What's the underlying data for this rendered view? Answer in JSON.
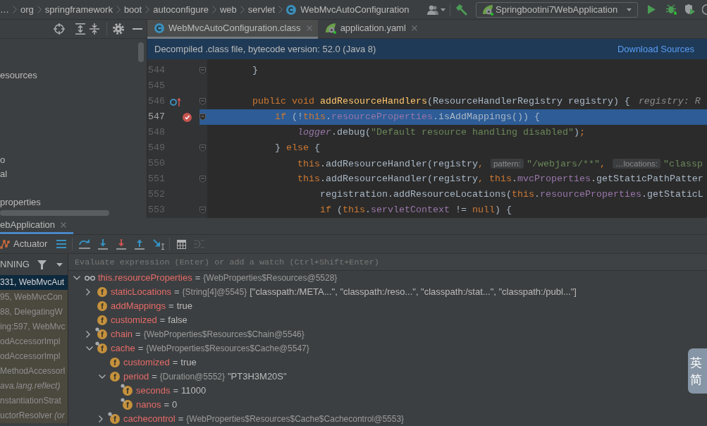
{
  "breadcrumbs": [
    {
      "kind": "package",
      "label": "…"
    },
    {
      "kind": "package",
      "label": "org"
    },
    {
      "kind": "package",
      "label": "springframework"
    },
    {
      "kind": "package",
      "label": "boot"
    },
    {
      "kind": "package",
      "label": "autoconfigure"
    },
    {
      "kind": "package",
      "label": "web"
    },
    {
      "kind": "package",
      "label": "servlet"
    },
    {
      "kind": "class",
      "label": "WebMvcAutoConfiguration"
    }
  ],
  "run_config": {
    "label": "Springbootini7WebApplication"
  },
  "editor_tabs": [
    {
      "kind": "class",
      "label": "WebMvcAutoConfiguration.class",
      "selected": true
    },
    {
      "kind": "yaml",
      "label": "application.yaml",
      "selected": false
    }
  ],
  "project_tree": [
    {
      "label": "esources"
    },
    {
      "label": "o"
    },
    {
      "label": "al"
    },
    {
      "label": "properties"
    }
  ],
  "banner": {
    "text": "Decompiled .class file, bytecode version: 52.0 (Java 8)",
    "link": "Download Sources"
  },
  "code_lines": [
    {
      "number": "544",
      "fold": true,
      "current": false,
      "breakpoint": false,
      "overrides": false,
      "tokens": [
        {
          "kind": "plain",
          "text": "}"
        }
      ]
    },
    {
      "number": "545",
      "fold": false,
      "current": false,
      "breakpoint": false,
      "overrides": false
    },
    {
      "number": "546",
      "fold": true,
      "current": false,
      "breakpoint": false,
      "overrides": true,
      "tokens": [
        {
          "kind": "keyword",
          "text": "public void "
        },
        {
          "kind": "method",
          "text": "addResourceHandlers"
        },
        {
          "kind": "plain",
          "text": "(ResourceHandlerRegistry registry) {"
        },
        {
          "kind": "inline_value",
          "text": "registry: R"
        }
      ],
      "children": [
        {
          "number": "547",
          "fold": true,
          "current": true,
          "breakpoint": true,
          "overrides": false,
          "tokens": [
            {
              "kind": "keyword",
              "text": "if"
            },
            {
              "kind": "plain",
              "text": " (!"
            },
            {
              "kind": "keyword",
              "text": "this"
            },
            {
              "kind": "plain",
              "text": "."
            },
            {
              "kind": "field",
              "text": "resourceProperties"
            },
            {
              "kind": "plain",
              "text": ".isAddMappings()) {"
            }
          ],
          "children": [
            {
              "number": "548",
              "fold": false,
              "current": false,
              "breakpoint": false,
              "overrides": false,
              "tokens": [
                {
                  "kind": "static_field",
                  "text": "logger"
                },
                {
                  "kind": "plain",
                  "text": ".debug("
                },
                {
                  "kind": "string",
                  "text": "\"Default resource handling disabled\""
                },
                {
                  "kind": "plain",
                  "text": ")"
                },
                {
                  "kind": "keyword",
                  "text": ";"
                }
              ]
            }
          ]
        },
        {
          "number": "549",
          "fold": true,
          "current": false,
          "breakpoint": false,
          "overrides": false,
          "tokens": [
            {
              "kind": "plain",
              "text": "} "
            },
            {
              "kind": "keyword",
              "text": "else"
            },
            {
              "kind": "plain",
              "text": " {"
            }
          ],
          "children": [
            {
              "number": "550",
              "fold": false,
              "current": false,
              "breakpoint": false,
              "overrides": false,
              "tokens": [
                {
                  "kind": "keyword",
                  "text": "this"
                },
                {
                  "kind": "plain",
                  "text": ".addResourceHandler(registry"
                },
                {
                  "kind": "keyword",
                  "text": ", "
                },
                {
                  "kind": "param_hint",
                  "text": "pattern:"
                },
                {
                  "kind": "string",
                  "text": "\"/webjars/**\""
                },
                {
                  "kind": "keyword",
                  "text": ", "
                },
                {
                  "kind": "param_hint",
                  "text": "…locations:"
                },
                {
                  "kind": "string",
                  "text": "\"classp"
                }
              ]
            },
            {
              "number": "551",
              "fold": true,
              "current": false,
              "breakpoint": false,
              "overrides": false,
              "tokens": [
                {
                  "kind": "keyword",
                  "text": "this"
                },
                {
                  "kind": "plain",
                  "text": ".addResourceHandler(registry"
                },
                {
                  "kind": "keyword",
                  "text": ", "
                },
                {
                  "kind": "keyword",
                  "text": "this"
                },
                {
                  "kind": "plain",
                  "text": "."
                },
                {
                  "kind": "field",
                  "text": "mvcProperties"
                },
                {
                  "kind": "plain",
                  "text": ".getStaticPathPatter"
                }
              ],
              "children": [
                {
                  "number": "552",
                  "fold": false,
                  "current": false,
                  "breakpoint": false,
                  "overrides": false,
                  "tokens": [
                    {
                      "kind": "plain",
                      "text": "registration.addResourceLocations("
                    },
                    {
                      "kind": "keyword",
                      "text": "this"
                    },
                    {
                      "kind": "plain",
                      "text": "."
                    },
                    {
                      "kind": "field",
                      "text": "resourceProperties"
                    },
                    {
                      "kind": "plain",
                      "text": ".getStaticL"
                    }
                  ]
                },
                {
                  "number": "553",
                  "fold": true,
                  "current": false,
                  "breakpoint": false,
                  "overrides": false,
                  "tokens": [
                    {
                      "kind": "keyword",
                      "text": "if"
                    },
                    {
                      "kind": "plain",
                      "text": " ("
                    },
                    {
                      "kind": "keyword",
                      "text": "this"
                    },
                    {
                      "kind": "plain",
                      "text": "."
                    },
                    {
                      "kind": "field",
                      "text": "servletContext"
                    },
                    {
                      "kind": "plain",
                      "text": " != "
                    },
                    {
                      "kind": "keyword",
                      "text": "null"
                    },
                    {
                      "kind": "plain",
                      "text": ") {"
                    }
                  ]
                }
              ]
            }
          ]
        }
      ]
    }
  ],
  "debug": {
    "tab": {
      "label": "ebApplication",
      "selected": true
    },
    "toolbar": {
      "actuator": "Actuator"
    },
    "thread": "NNING",
    "frames": [
      {
        "method": "331, WebMvcAut",
        "selected": true,
        "library": false
      },
      {
        "method": "95, WebMvcCon",
        "selected": false,
        "library": true
      },
      {
        "method": "88, DelegatingW",
        "selected": false,
        "library": true
      },
      {
        "method": "ing:597, WebMvc",
        "selected": false,
        "library": true
      },
      {
        "method": "odAccessorImpl",
        "selected": false,
        "library": true
      },
      {
        "method": "odAccessorImpl",
        "selected": false,
        "library": true
      },
      {
        "method": "MethodAccessorI",
        "selected": false,
        "library": true
      },
      {
        "package": "ava.lang.reflect)",
        "selected": false,
        "library": true
      },
      {
        "method": "nstantiationStrat",
        "selected": false,
        "library": true
      },
      {
        "method": "uctorResolver",
        "package": "(or",
        "selected": false,
        "library": true
      }
    ],
    "evaluate": {
      "placeholder": "Evaluate expression (Enter) or add a watch (Ctrl+Shift+Enter)"
    },
    "variables": [
      {
        "kind": "watch",
        "name": "this.resourceProperties",
        "op": "=",
        "type": "{WebProperties$Resources@5528}",
        "expanded": true,
        "children": [
          {
            "kind": "field",
            "badge": "f",
            "final": false,
            "name": "staticLocations",
            "op": "=",
            "type": "{String[4]@5545}",
            "value": "[\"classpath:/META...\", \"classpath:/reso...\", \"classpath:/stat...\", \"classpath:/publ...\"]",
            "expanded": false
          },
          {
            "kind": "field",
            "badge": "f",
            "final": false,
            "name": "addMappings",
            "op": "=",
            "value": "true"
          },
          {
            "kind": "field",
            "badge": "f",
            "final": false,
            "name": "customized",
            "op": "=",
            "value": "false"
          },
          {
            "kind": "field",
            "badge": "f",
            "final": true,
            "name": "chain",
            "op": "=",
            "type": "{WebProperties$Resources$Chain@5546}",
            "expanded": false
          },
          {
            "kind": "field",
            "badge": "f",
            "final": true,
            "name": "cache",
            "op": "=",
            "type": "{WebProperties$Resources$Cache@5547}",
            "expanded": true,
            "children": [
              {
                "kind": "field",
                "badge": "f",
                "final": false,
                "name": "customized",
                "op": "=",
                "value": "true"
              },
              {
                "kind": "field",
                "badge": "f",
                "final": false,
                "name": "period",
                "op": "=",
                "type": "{Duration@5552}",
                "value": "\"PT3H3M20S\"",
                "expanded": true,
                "children": [
                  {
                    "kind": "field",
                    "badge": "f",
                    "final": true,
                    "name": "seconds",
                    "op": "=",
                    "value": "11000"
                  },
                  {
                    "kind": "field",
                    "badge": "f",
                    "final": true,
                    "name": "nanos",
                    "op": "=",
                    "value": "0"
                  }
                ]
              },
              {
                "kind": "field",
                "badge": "f",
                "final": true,
                "name": "cachecontrol",
                "op": "=",
                "type": "{WebProperties$Resources$Cache$Cachecontrol@5553}",
                "expanded": false
              }
            ]
          }
        ]
      }
    ]
  },
  "ime_toolbar": [
    {
      "label": "英"
    },
    {
      "label": "简"
    }
  ]
}
